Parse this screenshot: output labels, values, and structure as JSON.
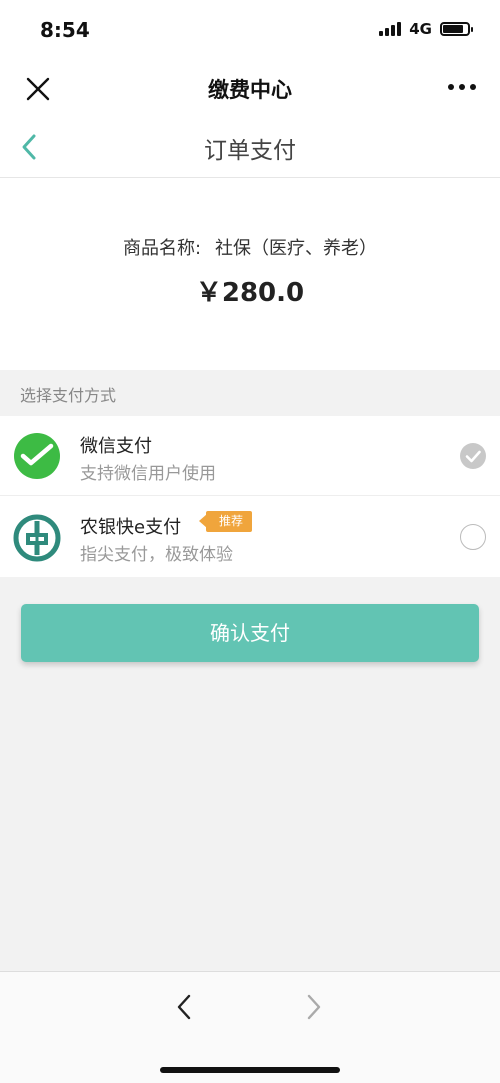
{
  "status_bar": {
    "time": "8:54",
    "network": "4G",
    "battery_level": 0.85
  },
  "header": {
    "title": "缴费中心"
  },
  "subheader": {
    "title": "订单支付"
  },
  "product": {
    "name_label": "商品名称:",
    "name_value": "社保（医疗、养老）",
    "price": "￥280.0"
  },
  "payment": {
    "section_label": "选择支付方式",
    "methods": [
      {
        "name": "微信支付",
        "description": "支持微信用户使用",
        "selected": true
      },
      {
        "name": "农银快e支付",
        "description": "指尖支付，极致体验",
        "badge": "推荐",
        "selected": false
      }
    ]
  },
  "confirm": {
    "label": "确认支付"
  },
  "colors": {
    "accent": "#62c4b3",
    "badge": "#f0a53c",
    "wechat_green": "#3dbb44",
    "abc_teal": "#2f8a7c"
  },
  "icons": {
    "close": "close-icon",
    "more": "more-icon",
    "back": "chevron-left-icon",
    "wechat": "wechat-pay-icon",
    "abc": "abc-bank-icon",
    "check": "check-circle-icon",
    "nav_back": "chevron-left-icon",
    "nav_forward": "chevron-right-icon"
  }
}
